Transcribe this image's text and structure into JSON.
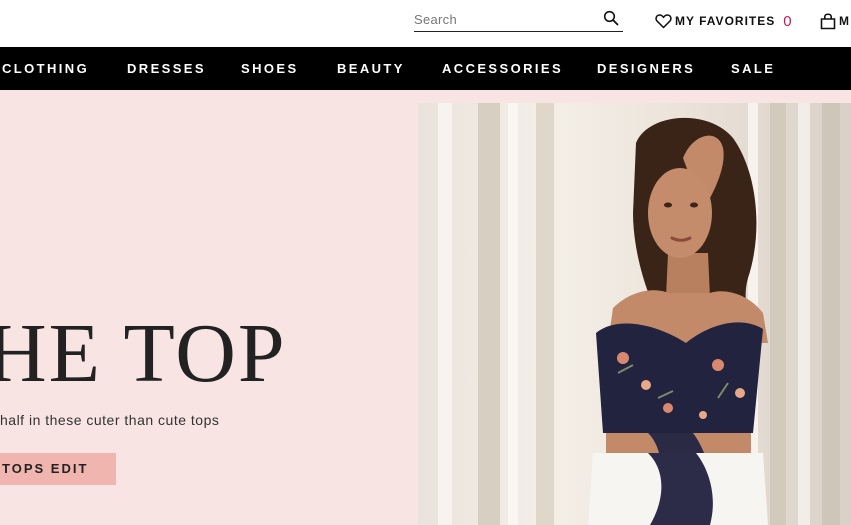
{
  "header": {
    "search": {
      "placeholder": "Search",
      "value": ""
    },
    "favorites": {
      "label": "MY FAVORITES",
      "count": "0"
    },
    "bag": {
      "label": "M"
    }
  },
  "nav": {
    "items": [
      "CLOTHING",
      "DRESSES",
      "SHOES",
      "BEAUTY",
      "ACCESSORIES",
      "DESIGNERS",
      "SALE"
    ]
  },
  "hero": {
    "title": "HE TOP",
    "subtitle": "half in these cuter than cute tops",
    "cta": "TOPS EDIT"
  },
  "colors": {
    "nav_bg": "#000000",
    "hero_bg": "#f8e4e3",
    "cta_bg": "#f0b5ae",
    "favorites_count": "#c2185b"
  }
}
